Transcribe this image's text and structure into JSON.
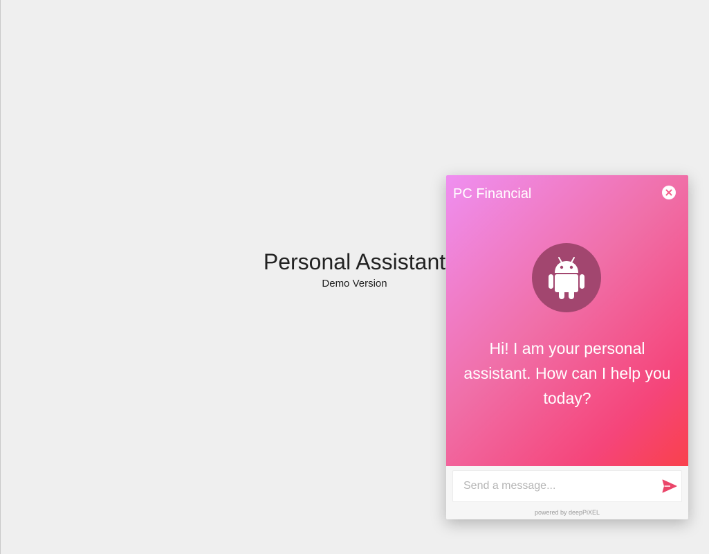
{
  "page": {
    "title": "Personal Assistant",
    "subtitle": "Demo Version"
  },
  "chat": {
    "header_title": "PC Financial",
    "greeting": "Hi! I am your personal assistant. How can I help you today?",
    "input_placeholder": "Send a message...",
    "input_value": "",
    "powered_by": "powered by deepPiXEL",
    "icons": {
      "close": "close-icon",
      "bot": "android-icon",
      "send": "send-icon"
    }
  },
  "colors": {
    "page_background": "#efefef",
    "gradient_start": "#ef8ff1",
    "gradient_end": "#f9414c",
    "avatar_background": "#a2466f",
    "send_icon": "#ea4569"
  }
}
